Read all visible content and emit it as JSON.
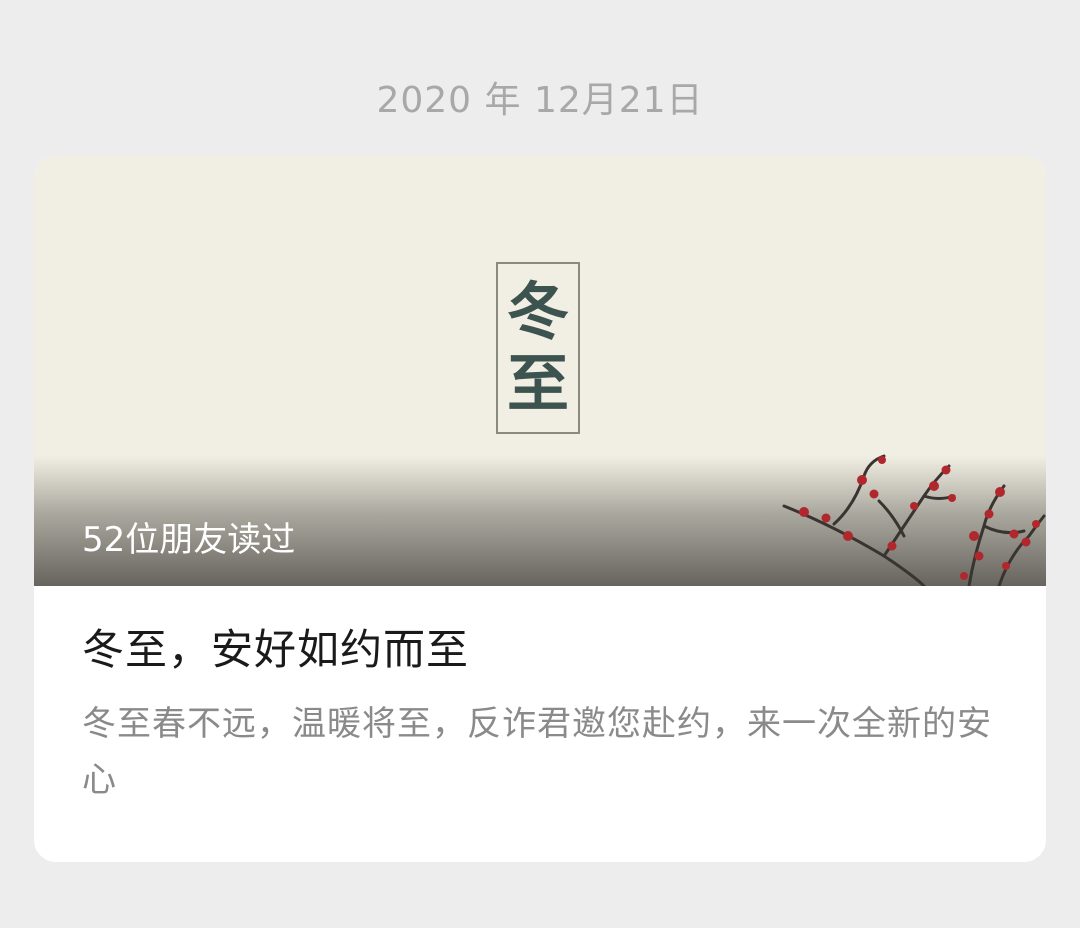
{
  "date": "2020 年 12月21日",
  "card": {
    "cover_chars": [
      "冬",
      "至"
    ],
    "read_count": "52位朋友读过",
    "title": "冬至，安好如约而至",
    "description": "冬至春不远，温暖将至，反诈君邀您赴约，来一次全新的安心"
  },
  "icons": {
    "cover_decoration": "plum-blossom-branch-icon"
  },
  "colors": {
    "background": "#ededed",
    "card": "#ffffff",
    "cover": "#f1efe3",
    "stamp_text": "#3d5350",
    "blossom": "#b0282e"
  }
}
